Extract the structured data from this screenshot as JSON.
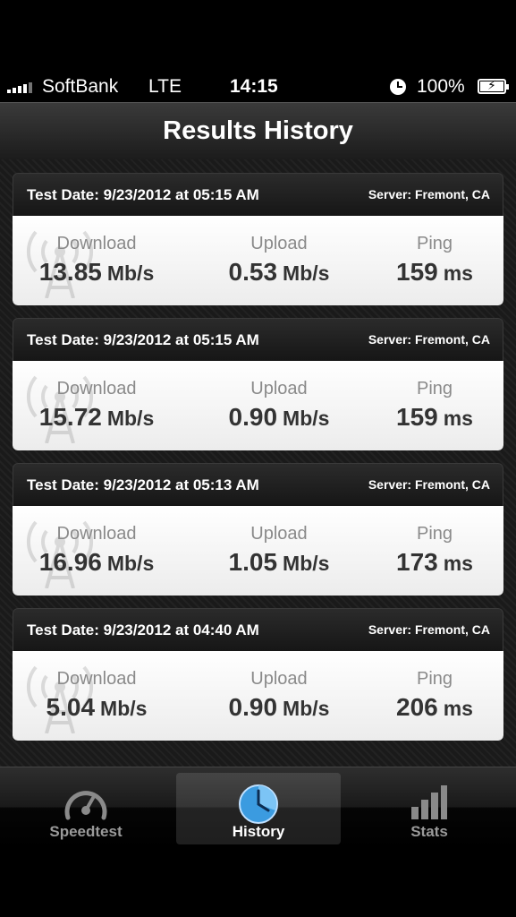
{
  "status_bar": {
    "carrier": "SoftBank",
    "network": "LTE",
    "time": "14:15",
    "battery": "100%"
  },
  "header": {
    "title": "Results History"
  },
  "results": [
    {
      "date": "Test Date: 9/23/2012 at 05:15 AM",
      "server": "Server: Fremont, CA",
      "download_label": "Download",
      "download_value": "13.85",
      "download_unit": "Mb/s",
      "upload_label": "Upload",
      "upload_value": "0.53",
      "upload_unit": "Mb/s",
      "ping_label": "Ping",
      "ping_value": "159",
      "ping_unit": "ms"
    },
    {
      "date": "Test Date: 9/23/2012 at 05:15 AM",
      "server": "Server: Fremont, CA",
      "download_label": "Download",
      "download_value": "15.72",
      "download_unit": "Mb/s",
      "upload_label": "Upload",
      "upload_value": "0.90",
      "upload_unit": "Mb/s",
      "ping_label": "Ping",
      "ping_value": "159",
      "ping_unit": "ms"
    },
    {
      "date": "Test Date: 9/23/2012 at 05:13 AM",
      "server": "Server: Fremont, CA",
      "download_label": "Download",
      "download_value": "16.96",
      "download_unit": "Mb/s",
      "upload_label": "Upload",
      "upload_value": "1.05",
      "upload_unit": "Mb/s",
      "ping_label": "Ping",
      "ping_value": "173",
      "ping_unit": "ms"
    },
    {
      "date": "Test Date: 9/23/2012 at 04:40 AM",
      "server": "Server: Fremont, CA",
      "download_label": "Download",
      "download_value": "5.04",
      "download_unit": "Mb/s",
      "upload_label": "Upload",
      "upload_value": "0.90",
      "upload_unit": "Mb/s",
      "ping_label": "Ping",
      "ping_value": "206",
      "ping_unit": "ms"
    }
  ],
  "tabs": [
    {
      "label": "Speedtest",
      "icon": "speedometer-icon"
    },
    {
      "label": "History",
      "icon": "clock-icon",
      "selected": true
    },
    {
      "label": "Stats",
      "icon": "bar-chart-icon"
    }
  ],
  "colors": {
    "accent": "#3b9be0",
    "card_bg": "#ffffff",
    "header_bg": "#1c1c1c"
  }
}
